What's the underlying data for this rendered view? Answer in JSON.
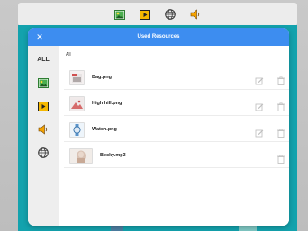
{
  "toolbar": {
    "icons": [
      "image-icon",
      "video-icon",
      "globe-icon",
      "speaker-icon"
    ]
  },
  "modal": {
    "title": "Used Resources",
    "close_label": "✕"
  },
  "sidebar": {
    "tabs": [
      {
        "label": "ALL"
      },
      {
        "icon": "image-icon"
      },
      {
        "icon": "video-icon"
      },
      {
        "icon": "speaker-icon"
      },
      {
        "icon": "globe-icon"
      }
    ]
  },
  "content": {
    "filter_label": "All",
    "rows": [
      {
        "name": "Bag.png",
        "type": "image",
        "editable": true
      },
      {
        "name": "High hill.png",
        "type": "image",
        "editable": true
      },
      {
        "name": "Watch.png",
        "type": "image",
        "editable": true
      },
      {
        "name": "Becky.mp3",
        "type": "audio",
        "editable": false
      }
    ]
  },
  "colors": {
    "header_blue": "#3d8df0",
    "background_teal": "#13a2ad",
    "icon_green": "#2e8b3a",
    "icon_yellow": "#f2b705"
  }
}
